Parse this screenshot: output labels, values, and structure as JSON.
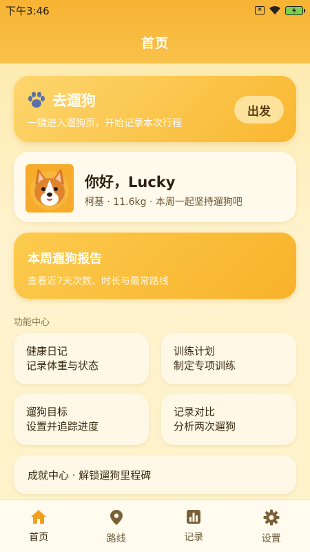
{
  "status": {
    "time": "下午3:46"
  },
  "header": {
    "title": "首页"
  },
  "walk": {
    "title": "去遛狗",
    "subtitle": "一键进入遛狗页，开始记录本次行程",
    "button": "出发",
    "icon": "paw-icon"
  },
  "profile": {
    "greeting": "你好，Lucky",
    "info": "柯基 · 11.6kg · 本周一起坚持遛狗吧",
    "avatar": "corgi-avatar"
  },
  "report": {
    "title": "本周遛狗报告",
    "subtitle": "查看近7天次数、时长与最常路线"
  },
  "functions": {
    "section_label": "功能中心",
    "items": [
      {
        "line1": "健康日记",
        "line2": "记录体重与状态"
      },
      {
        "line1": "训练计划",
        "line2": "制定专项训练"
      },
      {
        "line1": "遛狗目标",
        "line2": "设置并追踪进度"
      },
      {
        "line1": "记录对比",
        "line2": "分析两次遛狗"
      }
    ],
    "achievement": "成就中心 · 解锁遛狗里程碑"
  },
  "tabs": [
    {
      "label": "首页",
      "icon": "home-icon",
      "active": true
    },
    {
      "label": "路线",
      "icon": "location-pin-icon"
    },
    {
      "label": "记录",
      "icon": "bar-chart-icon"
    },
    {
      "label": "设置",
      "icon": "gear-icon"
    }
  ],
  "colors": {
    "accent": "#f7b333",
    "tab_active": "#f0a020",
    "tab_icon": "#7a6038"
  }
}
